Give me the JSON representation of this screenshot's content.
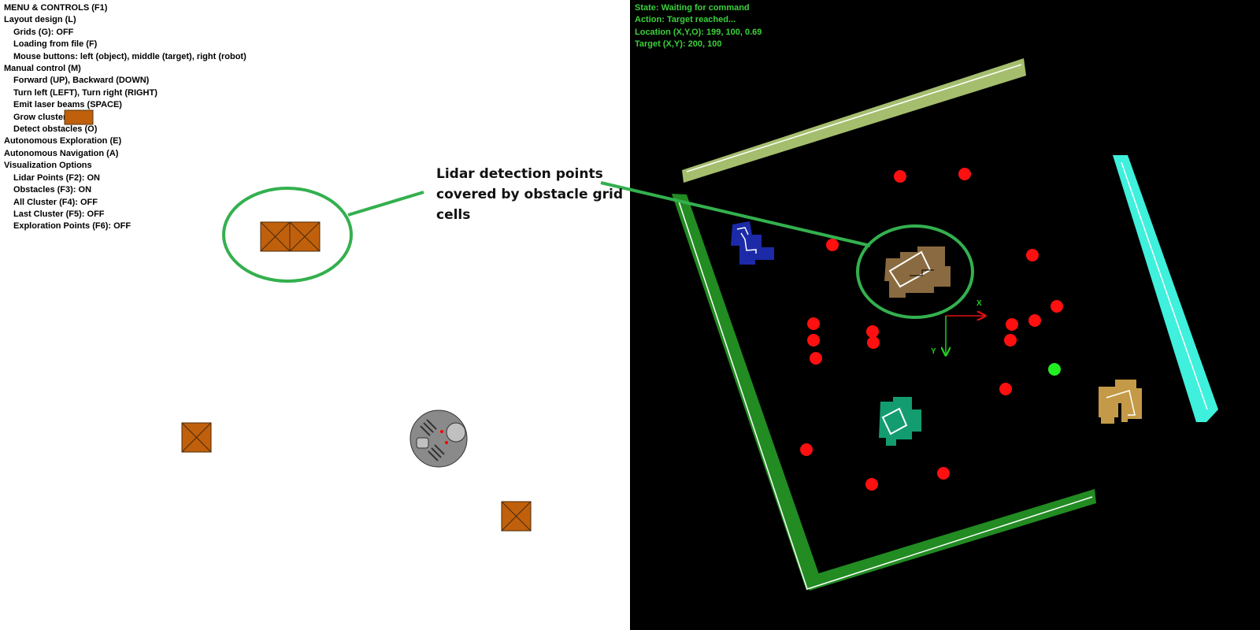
{
  "menu": {
    "title": "MENU & CONTROLS (F1)",
    "layout_design": "Layout design (L)",
    "grids": "Grids (G): OFF",
    "loading_from_file": "Loading from file (F)",
    "mouse_buttons": "Mouse buttons: left (object), middle (target), right (robot)",
    "manual_control": "Manual control (M)",
    "forward_backward": "Forward (UP), Backward (DOWN)",
    "turn_left_right": "Turn left (LEFT), Turn right (RIGHT)",
    "emit_laser": "Emit laser beams (SPACE)",
    "grow_cluster": "Grow cluster (C)",
    "detect_obstacles": "Detect obstacles (O)",
    "autonomous_exploration": "Autonomous Exploration (E)",
    "autonomous_navigation": "Autonomous Navigation (A)",
    "visualization_options": "Visualization Options",
    "lidar_points": "Lidar Points (F2): ON",
    "obstacles": "Obstacles (F3): ON",
    "all_cluster": "All Cluster (F4): OFF",
    "last_cluster": "Last Cluster (F5): OFF",
    "exploration_points": "Exploration Points (F6): OFF"
  },
  "status": {
    "state": "State: Waiting for command",
    "action": "Action: Target reached...",
    "location": "Location (X,Y,O): 199, 100, 0.69",
    "target": "Target (X,Y): 200, 100"
  },
  "annotation": {
    "text": "Lidar detection points covered by obstacle grid cells"
  },
  "axes": {
    "x_label": "X",
    "y_label": "Y"
  },
  "colors": {
    "crate": "#c0600c",
    "annotation_green": "#33b04e",
    "status_green": "#3bd13b",
    "wall_green": "#228b22",
    "wall_olive": "#a5be6e",
    "wall_cyan": "#3ff0dc",
    "cluster_blue": "#1c2aa8",
    "cluster_brown": "#8a6a40",
    "cluster_teal": "#139c70",
    "cluster_tan": "#c49a48",
    "exploration_red": "#ff1010",
    "robot_gray": "#8a8a8a"
  }
}
